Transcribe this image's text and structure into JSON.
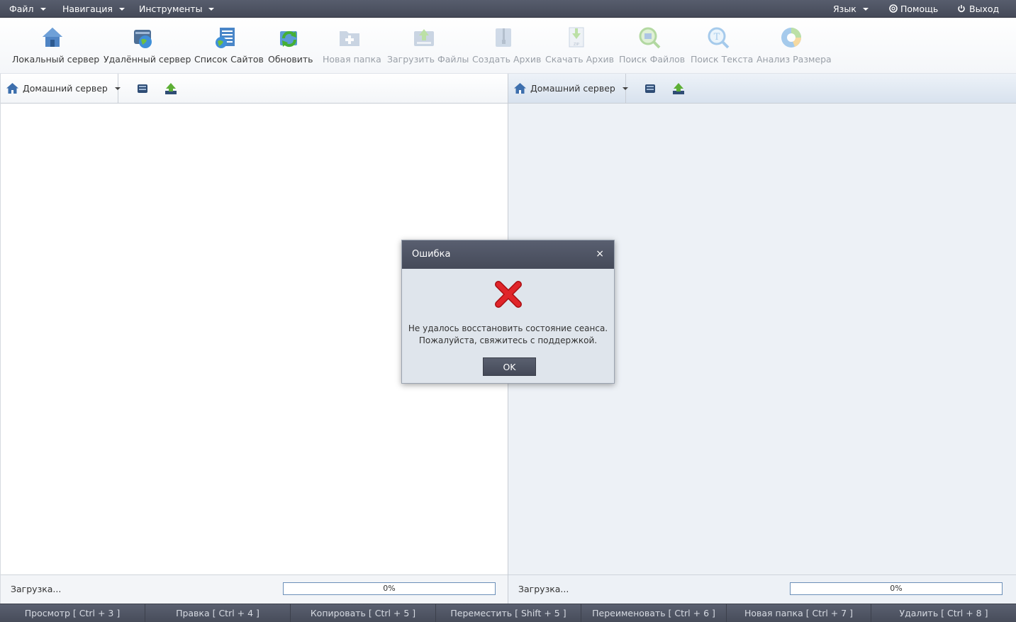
{
  "menubar": {
    "file": "Файл",
    "navigation": "Навигация",
    "tools": "Инструменты",
    "language": "Язык",
    "help": "Помощь",
    "exit": "Выход"
  },
  "toolbar": {
    "items": [
      {
        "label": "Локальный сервер",
        "icon": "local-server-icon",
        "enabled": true
      },
      {
        "label": "Удалённый сервер",
        "icon": "remote-server-icon",
        "enabled": true
      },
      {
        "label": "Список Сайтов",
        "icon": "site-list-icon",
        "enabled": true
      },
      {
        "label": "Обновить",
        "icon": "refresh-icon",
        "enabled": true
      },
      {
        "label": "Новая папка",
        "icon": "new-folder-icon",
        "enabled": false
      },
      {
        "label": "Загрузить Файлы",
        "icon": "upload-icon",
        "enabled": false
      },
      {
        "label": "Создать Архив",
        "icon": "archive-icon",
        "enabled": false
      },
      {
        "label": "Скачать Архив",
        "icon": "download-archive-icon",
        "enabled": false
      },
      {
        "label": "Поиск Файлов",
        "icon": "file-search-icon",
        "enabled": false
      },
      {
        "label": "Поиск Текста",
        "icon": "text-search-icon",
        "enabled": false
      },
      {
        "label": "Анализ Размера",
        "icon": "size-analysis-icon",
        "enabled": false
      }
    ]
  },
  "left_panel": {
    "location": "Домашний сервер",
    "status": "Загрузка...",
    "progress_text": "0%",
    "progress": 0
  },
  "right_panel": {
    "location": "Домашний сервер",
    "status": "Загрузка...",
    "progress_text": "0%",
    "progress": 0
  },
  "shortcuts": [
    "Просмотр [ Ctrl + 3 ]",
    "Правка [ Ctrl + 4 ]",
    "Копировать [ Ctrl + 5 ]",
    "Переместить [ Shift + 5 ]",
    "Переименовать [ Ctrl + 6 ]",
    "Новая папка [ Ctrl + 7 ]",
    "Удалить [ Ctrl + 8 ]"
  ],
  "dialog": {
    "title": "Ошибка",
    "close": "×",
    "message_line1": "Не удалось восстановить состояние сеанса.",
    "message_line2": "Пожалуйста, свяжитесь с поддержкой.",
    "ok": "OK",
    "icon": "error-x-icon"
  },
  "colors": {
    "menubar": "#4b5060",
    "panel_right_bg": "#edf1f6",
    "error_red": "#d0151b",
    "progress_border": "#6b8fb8"
  }
}
